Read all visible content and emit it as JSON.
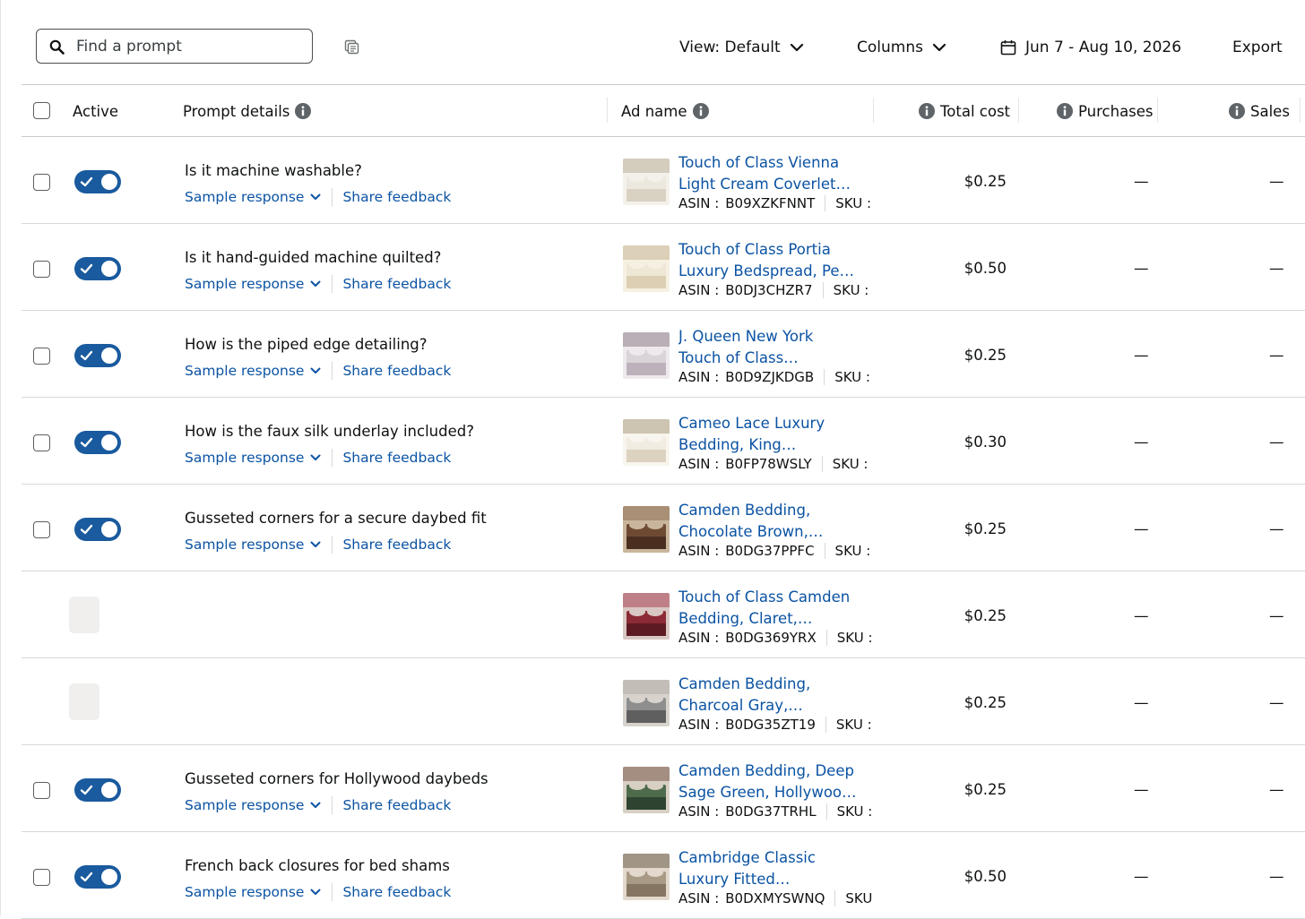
{
  "search": {
    "placeholder": "Find a prompt"
  },
  "toolbar": {
    "view_label": "View: Default",
    "columns_label": "Columns",
    "date_range": "Jun 7 - Aug 10, 2026",
    "export_label": "Export"
  },
  "columns": {
    "active": "Active",
    "prompt_details": "Prompt details",
    "ad_name": "Ad name",
    "total_cost": "Total cost",
    "purchases": "Purchases",
    "sales": "Sales"
  },
  "labels": {
    "sample_response": "Sample response",
    "share_feedback": "Share feedback",
    "asin": "ASIN :",
    "sku": "SKU :",
    "sku_last": "SKU",
    "empty": "—"
  },
  "colors": {
    "toggle_on": "#1a5a9e",
    "link": "#0b53a3"
  },
  "rows": [
    {
      "active": true,
      "prompt": "Is it machine washable?",
      "ad_line1": "Touch of Class Vienna",
      "ad_line2": "Light Cream Coverlet…",
      "asin": "B09XZKFNNT",
      "cost": "$0.25",
      "purchases": "—",
      "sales": "—"
    },
    {
      "active": true,
      "prompt": "Is it hand-guided machine quilted?",
      "ad_line1": "Touch of Class Portia",
      "ad_line2": "Luxury Bedspread, Pe…",
      "asin": "B0DJ3CHZR7",
      "cost": "$0.50",
      "purchases": "—",
      "sales": "—"
    },
    {
      "active": true,
      "prompt": "How is the piped edge detailing?",
      "ad_line1": "J. Queen New York",
      "ad_line2": "Touch of Class…",
      "asin": "B0D9ZJKDGB",
      "cost": "$0.25",
      "purchases": "—",
      "sales": "—"
    },
    {
      "active": true,
      "prompt": "How is the faux silk underlay included?",
      "ad_line1": "Cameo Lace Luxury",
      "ad_line2": "Bedding, King…",
      "asin": "B0FP78WSLY",
      "cost": "$0.30",
      "purchases": "—",
      "sales": "—"
    },
    {
      "active": true,
      "prompt": "Gusseted corners for a secure daybed fit",
      "ad_line1": "Camden Bedding,",
      "ad_line2": "Chocolate Brown,…",
      "asin": "B0DG37PPFC",
      "cost": "$0.25",
      "purchases": "—",
      "sales": "—"
    },
    {
      "active": null,
      "prompt": "",
      "ad_line1": "Touch of Class Camden",
      "ad_line2": "Bedding, Claret,…",
      "asin": "B0DG369YRX",
      "cost": "$0.25",
      "purchases": "—",
      "sales": "—"
    },
    {
      "active": null,
      "prompt": "",
      "ad_line1": "Camden Bedding,",
      "ad_line2": "Charcoal Gray,…",
      "asin": "B0DG35ZT19",
      "cost": "$0.25",
      "purchases": "—",
      "sales": "—"
    },
    {
      "active": true,
      "prompt": "Gusseted corners for Hollywood daybeds",
      "ad_line1": "Camden Bedding, Deep",
      "ad_line2": "Sage Green, Hollywoo…",
      "asin": "B0DG37TRHL",
      "cost": "$0.25",
      "purchases": "—",
      "sales": "—"
    },
    {
      "active": true,
      "prompt": "French back closures for bed shams",
      "ad_line1": "Cambridge Classic",
      "ad_line2": "Luxury Fitted…",
      "asin": "B0DXMYSWNQ",
      "cost": "$0.50",
      "purchases": "—",
      "sales": "—"
    }
  ]
}
